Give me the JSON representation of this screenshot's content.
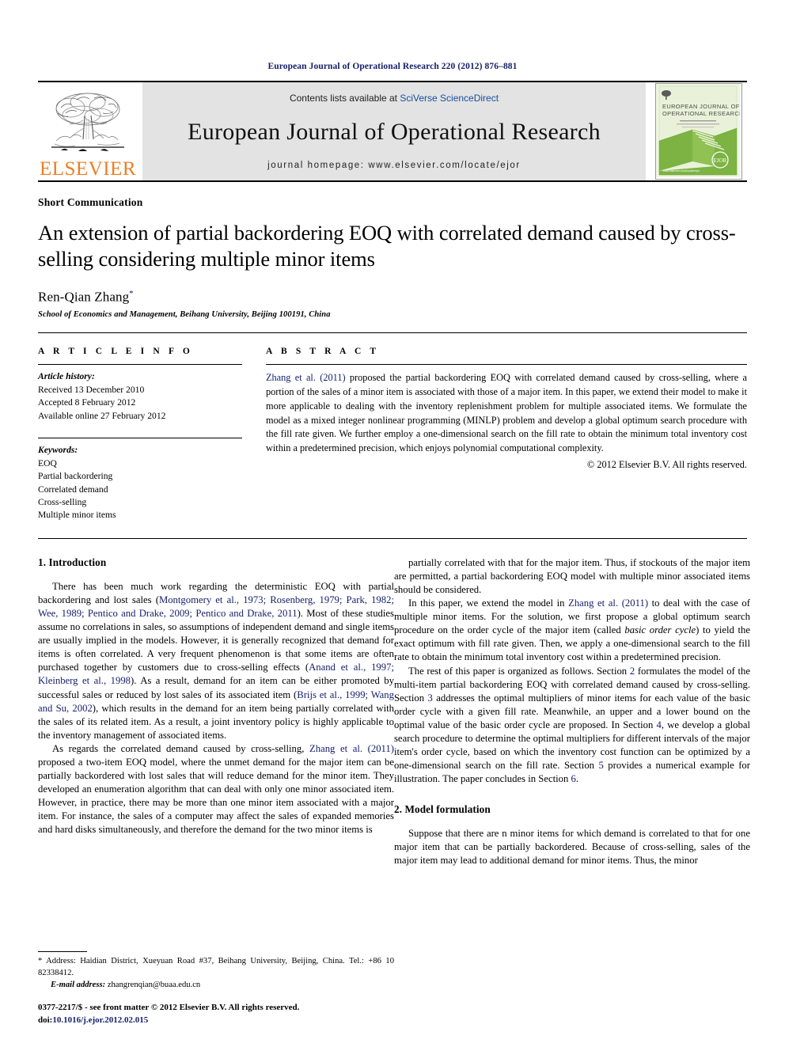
{
  "running_head": "European Journal of Operational Research 220 (2012) 876–881",
  "masthead": {
    "publisher_name": "ELSEVIER",
    "contents_prefix": "Contents lists available at ",
    "contents_link": "SciVerse ScienceDirect",
    "journal_name": "European Journal of Operational Research",
    "homepage_line": "journal homepage: www.elsevier.com/locate/ejor",
    "cover_title_line1": "EUROPEAN JOURNAL OF",
    "cover_title_line2": "OPERATIONAL RESEARCH",
    "cover_footer": "www.elsevier.com/locate/ejor",
    "cover_colors": {
      "green": "#7cb342",
      "pale": "#dfeccb"
    }
  },
  "article": {
    "type": "Short Communication",
    "title": "An extension of partial backordering EOQ with correlated demand caused by cross-selling considering multiple minor items",
    "author": "Ren-Qian Zhang",
    "author_marker": "*",
    "affiliation": "School of Economics and Management, Beihang University, Beijing 100191, China"
  },
  "article_info": {
    "heading": "A R T I C L E   I N F O",
    "history_label": "Article history:",
    "history": [
      "Received 13 December 2010",
      "Accepted 8 February 2012",
      "Available online 27 February 2012"
    ],
    "keywords_label": "Keywords:",
    "keywords": [
      "EOQ",
      "Partial backordering",
      "Correlated demand",
      "Cross-selling",
      "Multiple minor items"
    ]
  },
  "abstract": {
    "heading": "A B S T R A C T",
    "citation": "Zhang et al. (2011)",
    "text": " proposed the partial backordering EOQ with correlated demand caused by cross-selling, where a portion of the sales of a minor item is associated with those of a major item. In this paper, we extend their model to make it more applicable to dealing with the inventory replenishment problem for multiple associated items. We formulate the model as a mixed integer nonlinear programming (MINLP) problem and develop a global optimum search procedure with the fill rate given. We further employ a one-dimensional search on the fill rate to obtain the minimum total inventory cost within a predetermined precision, which enjoys polynomial computational complexity.",
    "copyright": "© 2012 Elsevier B.V. All rights reserved."
  },
  "sections": {
    "introduction_heading": "1. Introduction",
    "model_heading": "2. Model formulation"
  },
  "left_column": {
    "p1_a": "There has been much work regarding the deterministic EOQ with partial backordering and lost sales (",
    "p1_refs": "Montgomery et al., 1973; Rosenberg, 1979; Park, 1982; Wee, 1989; Pentico and Drake, 2009; Pentico and Drake, 2011",
    "p1_b": "). Most of these studies assume no correlations in sales, so assumptions of independent demand and single items are usually implied in the models. However, it is generally recognized that demand for items is often correlated. A very frequent phenomenon is that some items are often purchased together by customers due to cross-selling effects (",
    "p1_refs2": "Anand et al., 1997; Kleinberg et al., 1998",
    "p1_c": "). As a result, demand for an item can be either promoted by successful sales or reduced by lost sales of its associated item (",
    "p1_refs3": "Brijs et al., 1999; Wang and Su, 2002",
    "p1_d": "), which results in the demand for an item being partially correlated with the sales of its related item. As a result, a joint inventory policy is highly applicable to the inventory management of associated items.",
    "p2_a": "As regards the correlated demand caused by cross-selling, ",
    "p2_refs": "Zhang et al. (2011)",
    "p2_b": " proposed a two-item EOQ model, where the unmet demand for the major item can be partially backordered with lost sales that will reduce demand for the minor item. They developed an enumeration algorithm that can deal with only one minor associated item. However, in practice, there may be more than one minor item associated with a major item. For instance, the sales of a computer may affect the sales of expanded memories and hard disks simultaneously, and therefore the demand for the two minor items is"
  },
  "right_column": {
    "p1": "partially correlated with that for the major item. Thus, if stockouts of the major item are permitted, a partial backordering EOQ model with multiple minor associated items should be considered.",
    "p2_a": "In this paper, we extend the model in ",
    "p2_refs": "Zhang et al. (2011)",
    "p2_b": " to deal with the case of multiple minor items. For the solution, we first propose a global optimum search procedure on the order cycle of the major item (called ",
    "p2_ital": "basic order cycle",
    "p2_c": ") to yield the exact optimum with fill rate given. Then, we apply a one-dimensional search to the fill rate to obtain the minimum total inventory cost within a predetermined precision.",
    "p3_a": "The rest of this paper is organized as follows. Section ",
    "p3_n2": "2",
    "p3_b": " formulates the model of the multi-item partial backordering EOQ with correlated demand caused by cross-selling. Section ",
    "p3_n3": "3",
    "p3_c": " addresses the optimal multipliers of minor items for each value of the basic order cycle with a given fill rate. Meanwhile, an upper and a lower bound on the optimal value of the basic order cycle are proposed. In Section ",
    "p3_n4": "4",
    "p3_d": ", we develop a global search procedure to determine the optimal multipliers for different intervals of the major item's order cycle, based on which the inventory cost function can be optimized by a one-dimensional search on the fill rate. Section ",
    "p3_n5": "5",
    "p3_e": " provides a numerical example for illustration. The paper concludes in Section ",
    "p3_n6": "6",
    "p3_f": ".",
    "p4": "Suppose that there are n minor items for which demand is correlated to that for one major item that can be partially backordered. Because of cross-selling, sales of the major item may lead to additional demand for minor items. Thus, the minor"
  },
  "footnote": {
    "marker": "*",
    "address": " Address: Haidian District, Xueyuan Road #37, Beihang University, Beijing, China. Tel.: +86 10 82338412.",
    "email_label": "E-mail address:",
    "email": "zhangrenqian@buaa.edu.cn"
  },
  "imprint": {
    "issn_line": "0377-2217/$ - see front matter © 2012 Elsevier B.V. All rights reserved.",
    "doi_label": "doi:",
    "doi_value": "10.1016/j.ejor.2012.02.015"
  },
  "colors": {
    "link": "#16216b",
    "elsevier_orange": "#ef7d22",
    "masthead_grey": "#e3e3e3"
  }
}
